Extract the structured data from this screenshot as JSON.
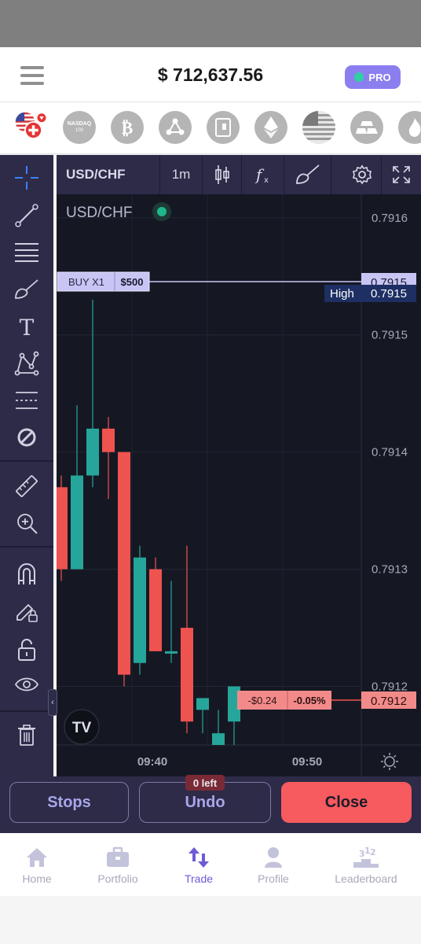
{
  "header": {
    "balance": "$ 712,637.56",
    "pro_label": "PRO"
  },
  "assets": [
    {
      "name": "usd-chf-flag-icon"
    },
    {
      "name": "nasdaq-icon",
      "label": "NASDAQ",
      "sub": "100"
    },
    {
      "name": "bitcoin-icon"
    },
    {
      "name": "ripple-icon"
    },
    {
      "name": "vault-icon"
    },
    {
      "name": "ethereum-icon"
    },
    {
      "name": "us-flag-icon"
    },
    {
      "name": "gold-bars-icon"
    },
    {
      "name": "fire-icon"
    }
  ],
  "chart_toolbar": {
    "symbol": "USD/CHF",
    "interval": "1m"
  },
  "chart": {
    "legend_symbol": "USD/CHF",
    "buy_label": "BUY X1",
    "buy_amount": "$500",
    "high_label": "High",
    "high_value": "0.7915",
    "buy_price_tag": "0.7915",
    "current_price_tag": "0.7912",
    "pnl_value": "-$0.24",
    "pnl_percent": "-0.05%",
    "logo": "TV",
    "colors": {
      "up": "#26a69a",
      "down": "#ef5350",
      "bg": "#151823"
    }
  },
  "chart_data": {
    "type": "candlestick",
    "title": "USD/CHF",
    "y_ticks": [
      "0.7916",
      "0.7915",
      "0.7914",
      "0.7913",
      "0.7912"
    ],
    "x_ticks": [
      "09:40",
      "09:50"
    ],
    "ylim": [
      0.79115,
      0.79162
    ],
    "candles": [
      {
        "open": 0.79137,
        "high": 0.79138,
        "low": 0.79129,
        "close": 0.7913
      },
      {
        "open": 0.7913,
        "high": 0.79144,
        "low": 0.7913,
        "close": 0.79138
      },
      {
        "open": 0.79138,
        "high": 0.79153,
        "low": 0.79137,
        "close": 0.79142
      },
      {
        "open": 0.79142,
        "high": 0.79143,
        "low": 0.79136,
        "close": 0.7914
      },
      {
        "open": 0.7914,
        "high": 0.7914,
        "low": 0.7912,
        "close": 0.79121
      },
      {
        "open": 0.79122,
        "high": 0.79132,
        "low": 0.79121,
        "close": 0.79131
      },
      {
        "open": 0.7913,
        "high": 0.79131,
        "low": 0.79123,
        "close": 0.79123
      },
      {
        "open": 0.79123,
        "high": 0.79129,
        "low": 0.79122,
        "close": 0.79123
      },
      {
        "open": 0.79125,
        "high": 0.79132,
        "low": 0.79116,
        "close": 0.79117
      },
      {
        "open": 0.79118,
        "high": 0.79119,
        "low": 0.79116,
        "close": 0.79119
      },
      {
        "open": 0.79115,
        "high": 0.79118,
        "low": 0.79115,
        "close": 0.79116
      },
      {
        "open": 0.79117,
        "high": 0.7912,
        "low": 0.79115,
        "close": 0.7912
      }
    ]
  },
  "footer": {
    "stops_label": "Stops",
    "undo_label": "Undo",
    "undo_badge": "0 left",
    "close_label": "Close"
  },
  "nav": {
    "home": "Home",
    "portfolio": "Portfolio",
    "trade": "Trade",
    "profile": "Profile",
    "leaderboard": "Leaderboard"
  }
}
